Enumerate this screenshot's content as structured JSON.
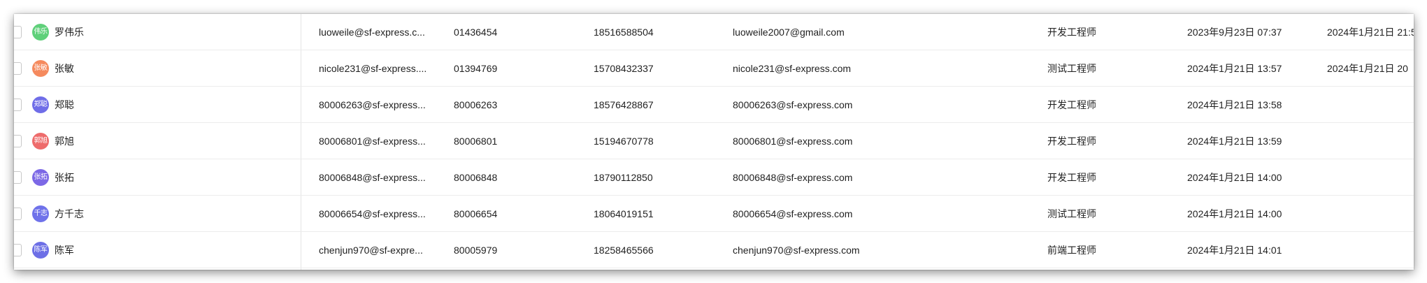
{
  "rows": [
    {
      "avatar_text": "伟乐",
      "avatar_color": "#5fd07a",
      "name": "罗伟乐",
      "account": "luoweile@sf-express.c...",
      "employee_no": "01436454",
      "phone": "18516588504",
      "email": "luoweile2007@gmail.com",
      "role": "开发工程师",
      "created_at": "2023年9月23日 07:37",
      "updated_at": "2024年1月21日 21:5"
    },
    {
      "avatar_text": "张敏",
      "avatar_color": "#f58a5e",
      "name": "张敏",
      "account": "nicole231@sf-express....",
      "employee_no": "01394769",
      "phone": "15708432337",
      "email": "nicole231@sf-express.com",
      "role": "测试工程师",
      "created_at": "2024年1月21日 13:57",
      "updated_at": "2024年1月21日 20"
    },
    {
      "avatar_text": "郑聪",
      "avatar_color": "#6f6de8",
      "name": "郑聪",
      "account": "80006263@sf-express...",
      "employee_no": "80006263",
      "phone": "18576428867",
      "email": "80006263@sf-express.com",
      "role": "开发工程师",
      "created_at": "2024年1月21日 13:58",
      "updated_at": ""
    },
    {
      "avatar_text": "郭旭",
      "avatar_color": "#ee6b6b",
      "name": "郭旭",
      "account": "80006801@sf-express...",
      "employee_no": "80006801",
      "phone": "15194670778",
      "email": "80006801@sf-express.com",
      "role": "开发工程师",
      "created_at": "2024年1月21日 13:59",
      "updated_at": ""
    },
    {
      "avatar_text": "张拓",
      "avatar_color": "#7c68e6",
      "name": "张拓",
      "account": "80006848@sf-express...",
      "employee_no": "80006848",
      "phone": "18790112850",
      "email": "80006848@sf-express.com",
      "role": "开发工程师",
      "created_at": "2024年1月21日 14:00",
      "updated_at": ""
    },
    {
      "avatar_text": "千志",
      "avatar_color": "#6f72ea",
      "name": "方千志",
      "account": "80006654@sf-express...",
      "employee_no": "80006654",
      "phone": "18064019151",
      "email": "80006654@sf-express.com",
      "role": "测试工程师",
      "created_at": "2024年1月21日 14:00",
      "updated_at": ""
    },
    {
      "avatar_text": "陈军",
      "avatar_color": "#6d6fe6",
      "name": "陈军",
      "account": "chenjun970@sf-expre...",
      "employee_no": "80005979",
      "phone": "18258465566",
      "email": "chenjun970@sf-express.com",
      "role": "前端工程师",
      "created_at": "2024年1月21日 14:01",
      "updated_at": ""
    }
  ]
}
